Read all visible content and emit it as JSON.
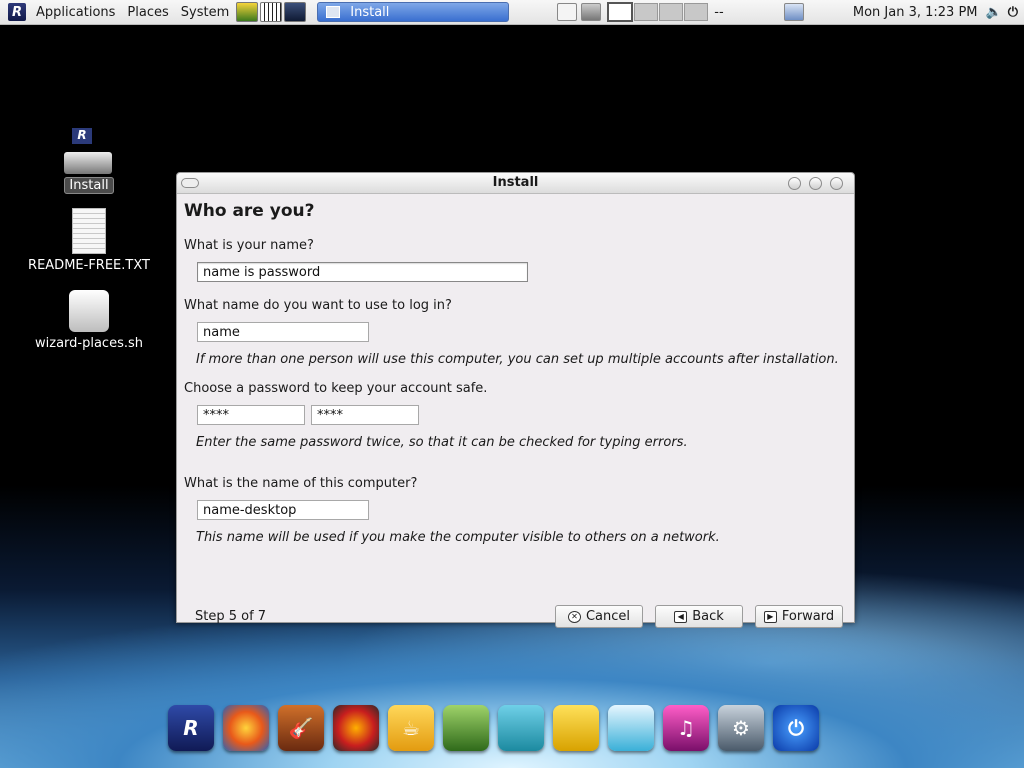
{
  "top_panel": {
    "logo_letter": "R",
    "menus": [
      "Applications",
      "Places",
      "System"
    ],
    "task_title": "Install",
    "workspace_label": "--",
    "clock": "Mon Jan  3,  1:23 PM"
  },
  "desktop_icons": {
    "install": "Install",
    "readme": "README-FREE.TXT",
    "wizard": "wizard-places.sh"
  },
  "window": {
    "title": "Install",
    "heading": "Who are you?",
    "name_label": "What is your name?",
    "name_value": "name is password",
    "login_label": "What name do you want to use to log in?",
    "login_value": "name",
    "login_hint": "If more than one person will use this computer, you can set up multiple accounts after installation.",
    "password_label": "Choose a password to keep your account safe.",
    "password_value": "****",
    "password_confirm_value": "****",
    "password_hint": "Enter the same password twice, so that it can be checked for typing errors.",
    "computer_label": "What is the name of this computer?",
    "computer_value": "name-desktop",
    "computer_hint": "This name will be used if you make the computer visible to others on a network.",
    "step": "Step 5 of 7",
    "buttons": {
      "cancel": "Cancel",
      "back": "Back",
      "forward": "Forward"
    }
  },
  "dock": {
    "items": [
      "logo-icon",
      "browser-icon",
      "guitar-icon",
      "media-icon",
      "coffee-icon",
      "photo-icon",
      "messenger-icon",
      "office-icon",
      "edit-icon",
      "music-icon",
      "settings-icon",
      "power-icon"
    ],
    "logo_letter": "R"
  }
}
